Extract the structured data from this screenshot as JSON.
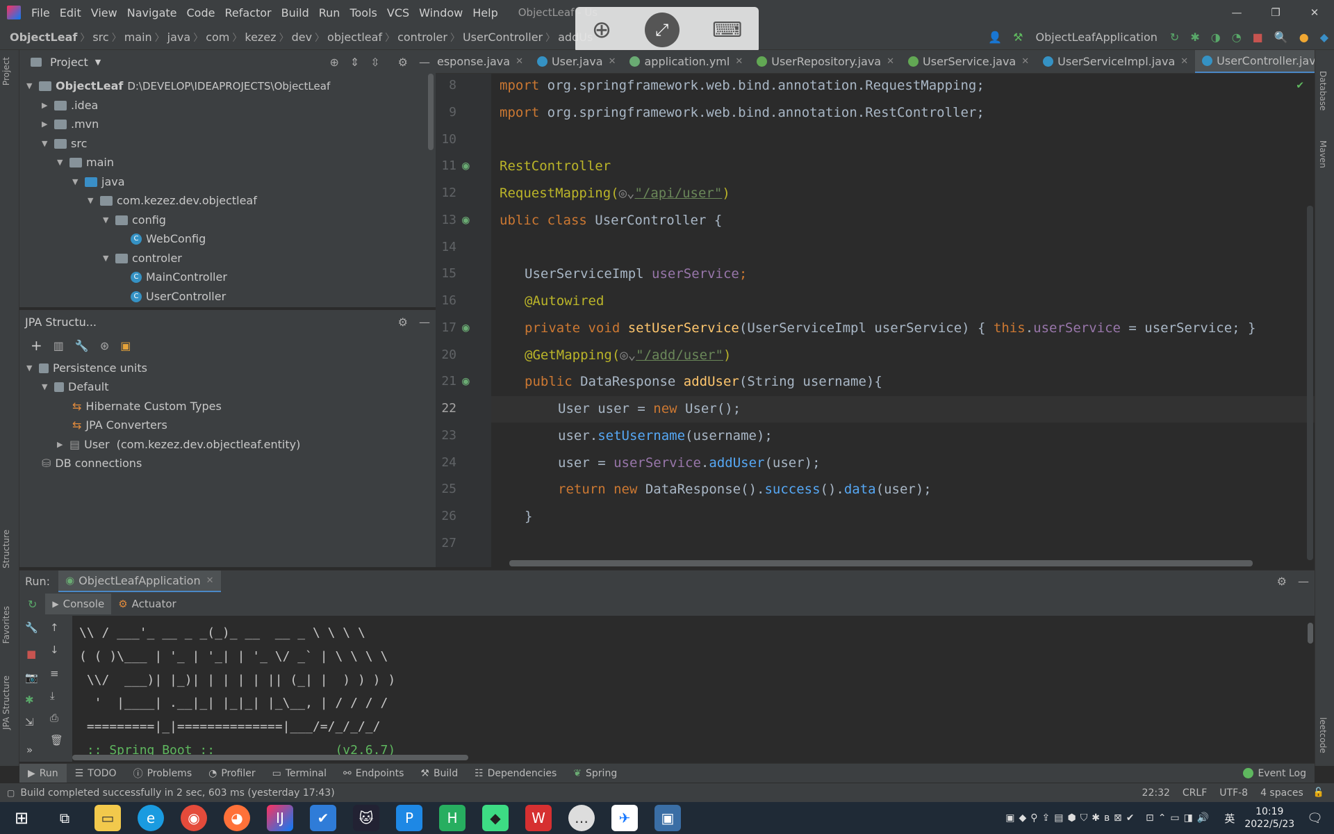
{
  "menu": {
    "items": [
      "File",
      "Edit",
      "View",
      "Navigate",
      "Code",
      "Refactor",
      "Build",
      "Run",
      "Tools",
      "VCS",
      "Window",
      "Help"
    ],
    "window_title": "ObjectLeaf - Us"
  },
  "breadcrumbs": [
    "ObjectLeaf",
    "src",
    "main",
    "java",
    "com",
    "kezez",
    "dev",
    "objectleaf",
    "controler",
    "UserController",
    "addUs"
  ],
  "run_config": "ObjectLeafApplication",
  "project_panel": {
    "title": "Project",
    "root_label": "ObjectLeaf",
    "root_path": "D:\\DEVELOP\\IDEAPROJECTS\\ObjectLeaf",
    "items": [
      ".idea",
      ".mvn",
      "src",
      "main",
      "java",
      "com.kezez.dev.objectleaf",
      "config",
      "WebConfig",
      "controler",
      "MainController",
      "UserController"
    ]
  },
  "jpa_panel": {
    "title": "JPA Structu...",
    "items": [
      "Persistence units",
      "Default",
      "Hibernate Custom Types",
      "JPA Converters",
      "User",
      "(com.kezez.dev.objectleaf.entity)",
      "DB connections"
    ]
  },
  "editor_tabs": [
    "esponse.java",
    "User.java",
    "application.yml",
    "UserRepository.java",
    "UserService.java",
    "UserServiceImpl.java",
    "UserController.java"
  ],
  "code": {
    "line_numbers": [
      "8",
      "9",
      "10",
      "11",
      "12",
      "13",
      "14",
      "15",
      "16",
      "17",
      "20",
      "21",
      "22",
      "23",
      "24",
      "25",
      "26",
      "27"
    ],
    "lines": {
      "l8a": "mport ",
      "l8b": "org.springframework.web.bind.annotation.RequestMapping;",
      "l9a": "mport ",
      "l9b": "org.springframework.web.bind.annotation.RestController;",
      "l11": "RestController",
      "l12a": "RequestMapping(",
      "l12b": "\"/api/user\"",
      "l12c": ")",
      "l13a": "ublic class ",
      "l13b": "UserController",
      "l13c": " {",
      "l15a": "UserServiceImpl ",
      "l15b": "userService",
      "l15c": ";",
      "l16": "@Autowired",
      "l17a": "private void ",
      "l17b": "setUserService",
      "l17c": "(UserServiceImpl userService) { ",
      "l17d": "this",
      "l17e": ".",
      "l17f": "userService",
      "l17g": " = userService; }",
      "l20a": "@GetMapping(",
      "l20b": "\"/add/user\"",
      "l20c": ")",
      "l21a": "public ",
      "l21b": "DataResponse ",
      "l21c": "addUser",
      "l21d": "(String username){",
      "l22a": "User ",
      "l22b": "user = ",
      "l22c": "new ",
      "l22d": "User",
      "l22e": "();",
      "l23a": "user.",
      "l23b": "setUsername",
      "l23c": "(username);",
      "l24a": "user = ",
      "l24b": "userService",
      "l24c": ".",
      "l24d": "addUser",
      "l24e": "(user);",
      "l25a": "return new ",
      "l25b": "DataResponse",
      "l25c": "().",
      "l25d": "success",
      "l25e": "().",
      "l25f": "data",
      "l25g": "(user);",
      "l26": "}"
    }
  },
  "run_panel": {
    "label": "Run:",
    "tab": "ObjectLeafApplication",
    "subtabs": [
      "Console",
      "Actuator"
    ],
    "console_lines": [
      "\\\\ / ___'_ __ _ _(_)_ __  __ _ \\ \\ \\ \\",
      "( ( )\\___ | '_ | '_| | '_ \\/ _` | \\ \\ \\ \\",
      " \\\\/  ___)| |_)| | | | | || (_| |  ) ) ) )",
      "  '  |____| .__|_| |_|_| |_\\__, | / / / /",
      " =========|_|==============|___/=/_/_/_/",
      " :: Spring Boot ::                (v2.6.7)"
    ]
  },
  "bottom_tools": [
    "Run",
    "TODO",
    "Problems",
    "Profiler",
    "Terminal",
    "Endpoints",
    "Build",
    "Dependencies",
    "Spring"
  ],
  "event_log": "Event Log",
  "status": {
    "message": "Build completed successfully in 2 sec, 603 ms (yesterday 17:43)",
    "position": "22:32",
    "line_sep": "CRLF",
    "encoding": "UTF-8",
    "indent": "4 spaces"
  },
  "side_labels": {
    "project": "Project",
    "structure": "Structure",
    "favorites": "Favorites",
    "jpa": "JPA Structure",
    "database": "Database",
    "maven": "Maven",
    "leetcode": "leetcode"
  },
  "taskbar": {
    "time": "10:19",
    "date": "2022/5/23",
    "ime": "英"
  }
}
